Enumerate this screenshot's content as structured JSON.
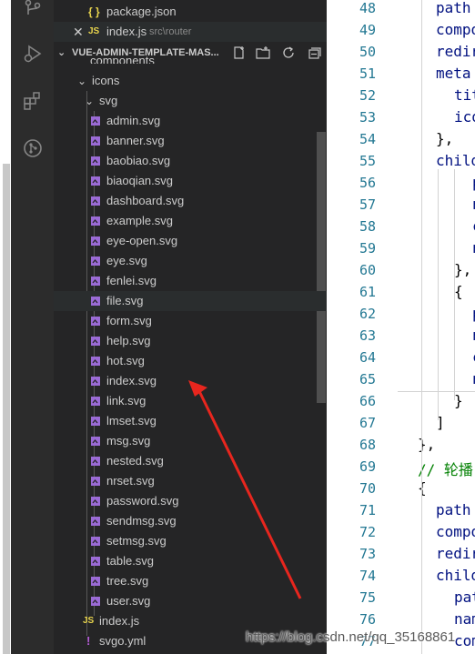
{
  "open_editors": [
    {
      "name": "package.json",
      "path": ""
    },
    {
      "name": "index.js",
      "path": "src\\router"
    }
  ],
  "explorer": {
    "title": "VUE-ADMIN-TEMPLATE-MAS...",
    "partial_item": "components",
    "icons_folder": "icons",
    "svg_folder": "svg",
    "svg_files": [
      "admin.svg",
      "banner.svg",
      "baobiao.svg",
      "biaoqian.svg",
      "dashboard.svg",
      "example.svg",
      "eye-open.svg",
      "eye.svg",
      "fenlei.svg",
      "file.svg",
      "form.svg",
      "help.svg",
      "hot.svg",
      "index.svg",
      "link.svg",
      "lmset.svg",
      "msg.svg",
      "nested.svg",
      "nrset.svg",
      "password.svg",
      "sendmsg.svg",
      "setmsg.svg",
      "table.svg",
      "tree.svg",
      "user.svg"
    ],
    "icons_files": [
      {
        "name": "index.js",
        "badge": "JS"
      },
      {
        "name": "svgo.yml",
        "badge": "!"
      }
    ]
  },
  "editor": {
    "lines": [
      {
        "n": "48",
        "text": "path"
      },
      {
        "n": "49",
        "text": "compo"
      },
      {
        "n": "50",
        "text": "redir"
      },
      {
        "n": "51",
        "text": "meta"
      },
      {
        "n": "52",
        "text": "tit"
      },
      {
        "n": "53",
        "text": "ico"
      },
      {
        "n": "54",
        "text": "},"
      },
      {
        "n": "55",
        "text": "childr"
      },
      {
        "n": "56",
        "text": "p"
      },
      {
        "n": "57",
        "text": "n"
      },
      {
        "n": "58",
        "text": "c"
      },
      {
        "n": "59",
        "text": "n"
      },
      {
        "n": "60",
        "text": "},"
      },
      {
        "n": "61",
        "text": "{"
      },
      {
        "n": "62",
        "text": "p"
      },
      {
        "n": "63",
        "text": "n"
      },
      {
        "n": "64",
        "text": "c"
      },
      {
        "n": "65",
        "text": "n"
      },
      {
        "n": "66",
        "text": "}"
      },
      {
        "n": "67",
        "text": "]"
      },
      {
        "n": "68",
        "text": "},"
      },
      {
        "n": "69",
        "text": "// 轮播"
      },
      {
        "n": "70",
        "text": "{"
      },
      {
        "n": "71",
        "text": "path"
      },
      {
        "n": "72",
        "text": "compo"
      },
      {
        "n": "73",
        "text": "redir"
      },
      {
        "n": "74",
        "text": "childr"
      },
      {
        "n": "75",
        "text": "pat"
      },
      {
        "n": "76",
        "text": "nam"
      },
      {
        "n": "77",
        "text": "com"
      }
    ]
  },
  "watermark": "https://blog.csdn.net/qq_35168861",
  "colors": {
    "activity_bar": "#2c2c2c",
    "sidebar": "#252526",
    "svg_icon": "#9b6bd6",
    "js_badge": "#e8d44d",
    "arrow": "#e8261e"
  }
}
